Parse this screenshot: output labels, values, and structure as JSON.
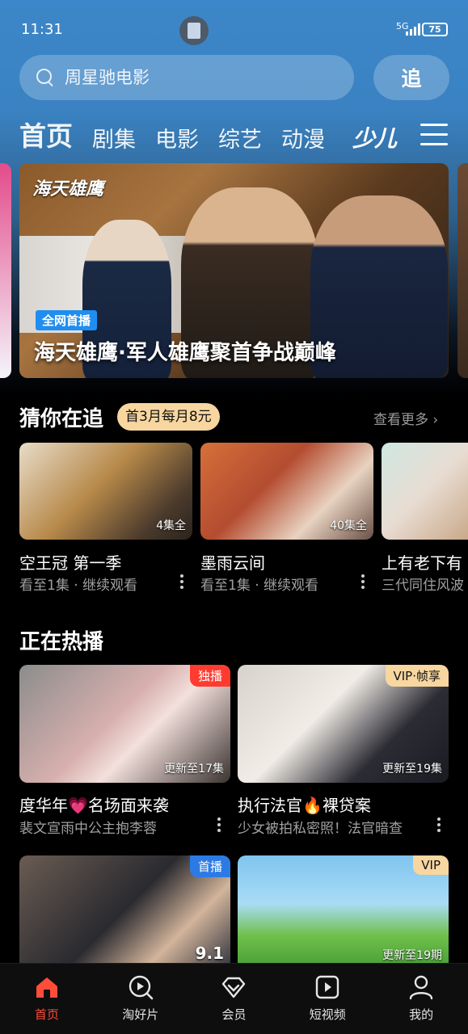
{
  "status_bar": {
    "time": "11:31",
    "network": "5G",
    "battery": "75"
  },
  "search": {
    "placeholder": "周星驰电影",
    "follow_label": "追"
  },
  "tabs": [
    "首页",
    "剧集",
    "电影",
    "综艺",
    "动漫"
  ],
  "kids_tab": "少儿",
  "banner": {
    "logo": "海天雄鹰",
    "tag": "全网首播",
    "caption": "海天雄鹰·军人雄鹰聚首争战巅峰"
  },
  "continue_section": {
    "title": "猜你在追",
    "promo": "首3月每月8元",
    "more": "查看更多",
    "items": [
      {
        "title": "空王冠 第一季",
        "subtitle": "看至1集 · 继续观看",
        "episodes": "4集全"
      },
      {
        "title": "墨雨云间",
        "subtitle": "看至1集 · 继续观看",
        "episodes": "40集全"
      },
      {
        "title": "上有老下有",
        "subtitle": "三代同住风波",
        "episodes": ""
      }
    ]
  },
  "hot_section": {
    "title": "正在热播",
    "items": [
      {
        "title": "度华年💗名场面来袭",
        "subtitle": "裴文宣雨中公主抱李蓉",
        "badge": "独播",
        "update": "更新至17集"
      },
      {
        "title": "执行法官🔥裸贷案",
        "subtitle": "少女被拍私密照！法官暗查",
        "badge": "VIP·帧享",
        "update": "更新至19集"
      },
      {
        "title": "",
        "subtitle": "",
        "badge": "首播",
        "update": "9.1"
      },
      {
        "title": "",
        "subtitle": "",
        "badge": "VIP",
        "update": "更新至19期"
      }
    ]
  },
  "bottom_nav": [
    "首页",
    "淘好片",
    "会员",
    "短视频",
    "我的"
  ],
  "colors": {
    "accent": "#ff4d3a",
    "header_blue": "#3c87c9",
    "promo_gold": "#f7d6a0"
  }
}
